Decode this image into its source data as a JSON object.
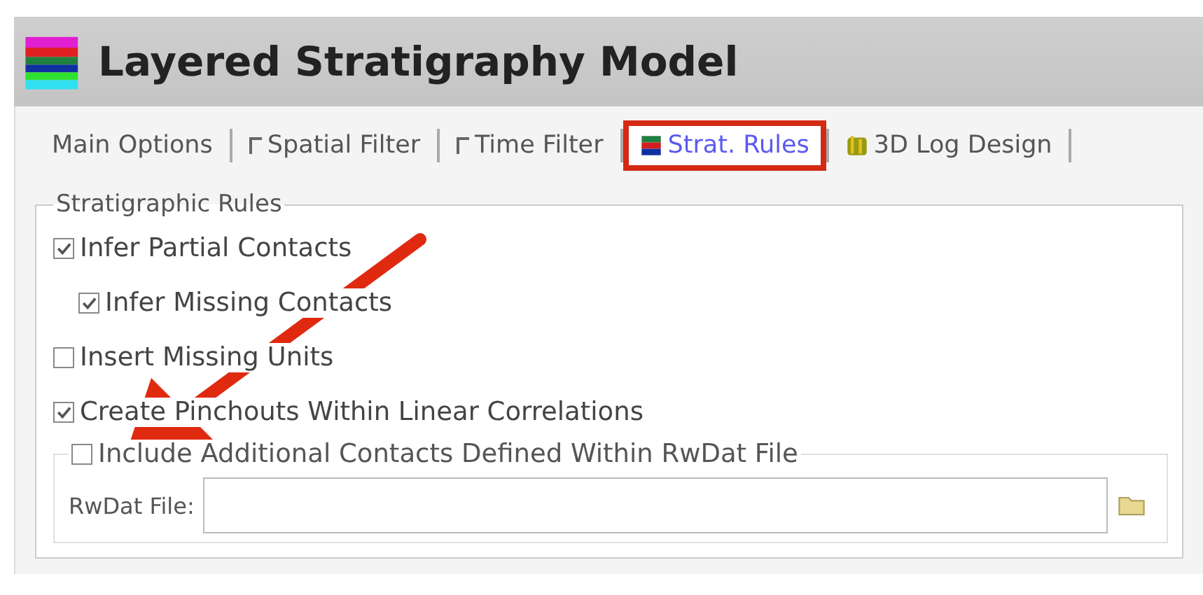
{
  "window": {
    "title": "Layered Stratigraphy Model"
  },
  "tabs": [
    {
      "label": "Main Options",
      "kind": "plain",
      "selected": false
    },
    {
      "label": "Spatial Filter",
      "kind": "toggle",
      "checked": false,
      "selected": false
    },
    {
      "label": "Time Filter",
      "kind": "toggle",
      "checked": false,
      "selected": false
    },
    {
      "label": "Strat. Rules",
      "kind": "icon",
      "selected": true
    },
    {
      "label": "3D Log Design",
      "kind": "icon",
      "selected": false
    }
  ],
  "group": {
    "title": "Stratigraphic Rules",
    "options": [
      {
        "label": "Infer Partial Contacts",
        "checked": true,
        "children": [
          {
            "label": "Infer Missing Contacts",
            "checked": true
          }
        ]
      },
      {
        "label": "Insert Missing Units",
        "checked": false
      },
      {
        "label": "Create Pinchouts Within Linear Correlations",
        "checked": true
      }
    ]
  },
  "subgroup": {
    "label": "Include Additional Contacts Defined Within RwDat File",
    "checked": false,
    "field_label": "RwDat File:"
  }
}
